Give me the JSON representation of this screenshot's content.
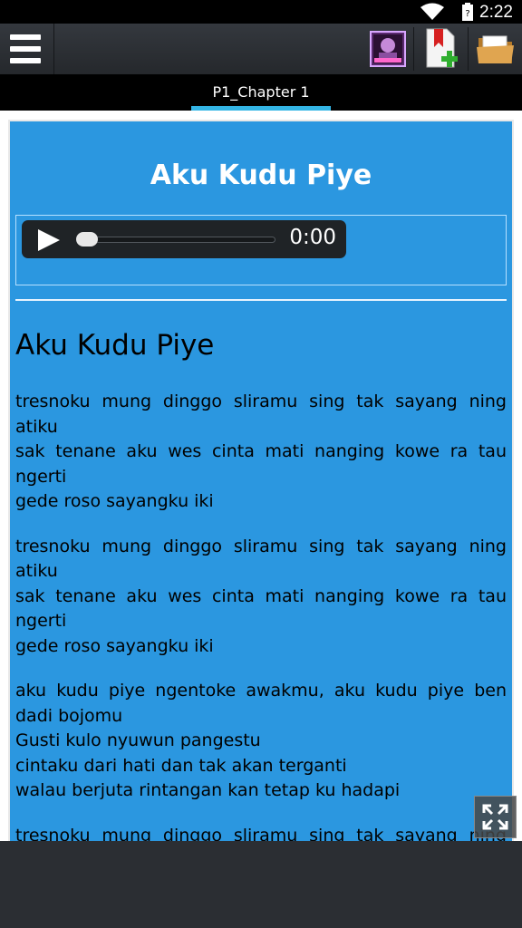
{
  "status": {
    "time": "2:22"
  },
  "tabs": [
    {
      "label": "P1_Chapter 1",
      "selected": true
    }
  ],
  "page": {
    "title": "Aku Kudu Piye"
  },
  "player": {
    "time": "0:00",
    "progress": 0
  },
  "lyrics": {
    "title": "Aku Kudu Piye",
    "stanzas": [
      [
        "tresnoku mung dinggo sliramu sing tak sayang ning atiku",
        "sak tenane aku wes cinta mati nanging kowe ra tau ngerti",
        "gede roso sayangku iki"
      ],
      [
        "tresnoku mung dinggo sliramu sing tak sayang ning atiku",
        "sak tenane aku wes cinta mati nanging kowe ra tau ngerti",
        "gede roso sayangku iki"
      ],
      [
        "aku kudu piye ngentoke awakmu, aku kudu piye ben dadi bojomu",
        "Gusti kulo nyuwun pangestu",
        "cintaku dari hati dan tak akan terganti",
        "walau berjuta rintangan kan tetap ku hadapi"
      ],
      [
        "tresnoku mung dinggo sliramu sing tak sayang ning atiku"
      ]
    ]
  },
  "icons": {
    "menu": "hamburger-menu-icon",
    "avatar": "avatar-icon",
    "bookmark": "bookmark-add-icon",
    "folder": "folder-open-icon",
    "fullscreen": "fullscreen-icon"
  }
}
